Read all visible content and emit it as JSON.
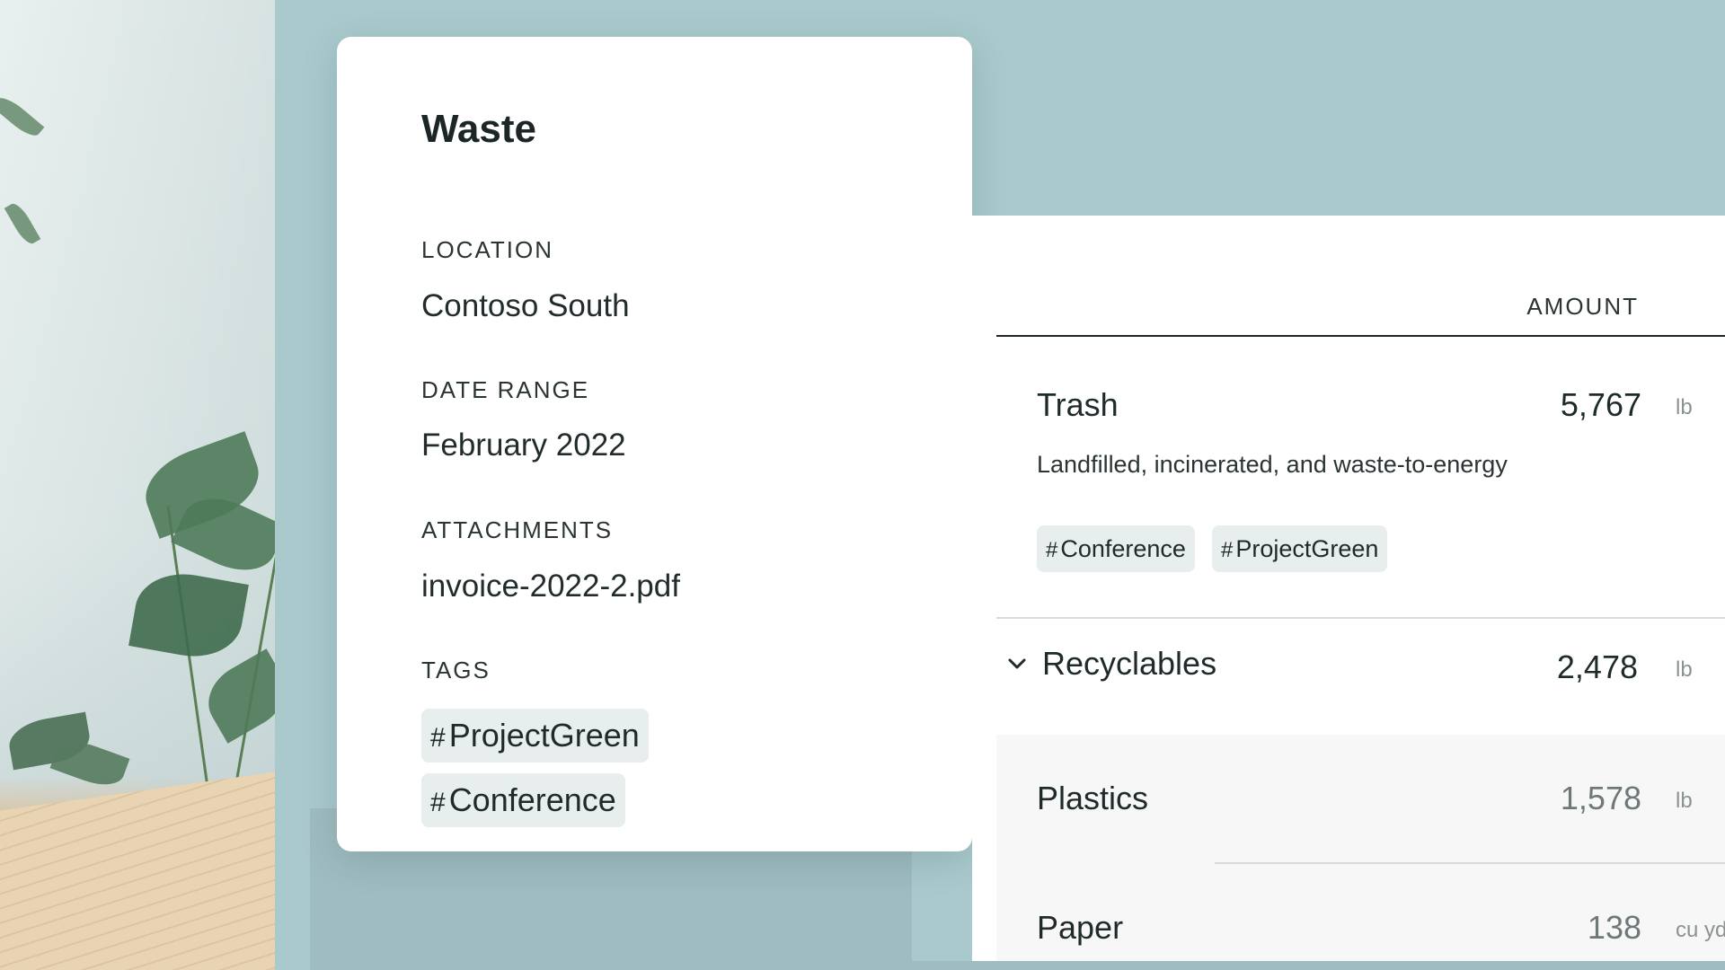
{
  "detail": {
    "title": "Waste",
    "location_label": "LOCATION",
    "location_value": "Contoso South",
    "date_label": "DATE RANGE",
    "date_value": "February 2022",
    "attachments_label": "ATTACHMENTS",
    "attachment_file": "invoice-2022-2.pdf",
    "tags_label": "TAGS",
    "tags": [
      "ProjectGreen",
      "Conference"
    ]
  },
  "amounts": {
    "header": "AMOUNT",
    "trash": {
      "name": "Trash",
      "value": "5,767",
      "unit": "lb",
      "description": "Landfilled, incinerated, and waste-to-energy",
      "tags": [
        "Conference",
        "ProjectGreen"
      ]
    },
    "recyclables": {
      "name": "Recyclables",
      "value": "2,478",
      "unit": "lb"
    },
    "plastics": {
      "name": "Plastics",
      "value": "1,578",
      "unit": "lb"
    },
    "paper": {
      "name": "Paper",
      "value": "138",
      "unit": "cu yd"
    }
  },
  "icons": {
    "chevron": "chevron-down-icon",
    "hash": "#"
  },
  "colors": {
    "background": "#a9c9cd",
    "card": "#ffffff",
    "chip": "#e8eeee",
    "text": "#1f2a2a",
    "muted": "#8a9292"
  }
}
